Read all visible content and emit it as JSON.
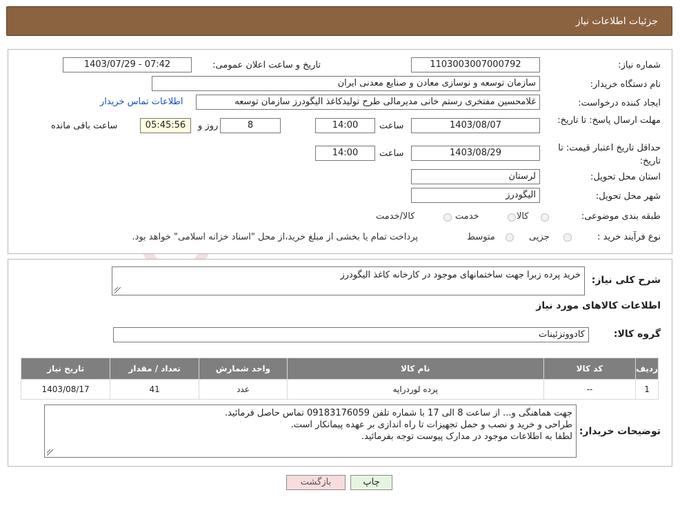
{
  "header": {
    "title": "جزئیات اطلاعات نیاز"
  },
  "form": {
    "need_number_label": "شماره نیاز:",
    "need_number": "1103003007000792",
    "announce_label": "تاریخ و ساعت اعلان عمومی:",
    "announce_value": "1403/07/29 - 07:42",
    "buyer_org_label": "نام دستگاه خریدار:",
    "buyer_org": "سازمان توسعه و نوسازی معادن و صنایع معدنی ایران",
    "creator_label": "ایجاد کننده درخواست:",
    "creator": "غلامحسین مفتخری رستم خانی مدیرمالی طرح تولیدکاغذ الیگودرز سازمان توسعه",
    "contact_link": "اطلاعات تماس خریدار",
    "reply_deadline_label": "مهلت ارسال پاسخ: تا تاریخ:",
    "reply_date": "1403/08/07",
    "time_label": "ساعت",
    "reply_time": "14:00",
    "days_value": "8",
    "day_and_label": "روز و",
    "remaining_time": "05:45:56",
    "remaining_label": "ساعت باقی مانده",
    "price_validity_label": "حداقل تاریخ اعتبار قیمت: تا تاریخ:",
    "price_date": "1403/08/29",
    "price_time": "14:00",
    "province_label": "استان محل تحویل:",
    "province": "لرستان",
    "city_label": "شهر محل تحویل:",
    "city": "الیگودرز",
    "category_label": "طبقه بندی موضوعی:",
    "category_options": [
      "کالا",
      "خدمت",
      "کالا/خدمت"
    ],
    "process_label": "نوع فرآیند خرید :",
    "process_options": [
      "جزیی",
      "متوسط"
    ],
    "process_note": "پرداخت تمام یا بخشی از مبلغ خرید،از محل \"اسناد خزانه اسلامی\" خواهد بود."
  },
  "details": {
    "summary_label": "شرح کلی نیاز:",
    "summary": "خرید پرده زبرا جهت ساختمانهای موجود در کارخانه کاغذ الیگودرز",
    "goods_info_title": "اطلاعات کالاهای مورد نیاز",
    "goods_group_label": "گروه کالا:",
    "goods_group": "کادووتزئینات",
    "table": {
      "headers": [
        "ردیف",
        "کد کالا",
        "نام کالا",
        "واحد شمارش",
        "تعداد / مقدار",
        "تاریخ نیاز"
      ],
      "rows": [
        [
          "1",
          "--",
          "پرده لوردراپه",
          "عدد",
          "41",
          "1403/08/17"
        ]
      ]
    },
    "buyer_notes_label": "توضیحات خریدار:",
    "buyer_notes": [
      "جهت هماهنگی و... از ساعت 8 الی 17 با شماره تلفن 09183176059 تماس حاصل فرمائید.",
      "طراحی و خرید و نصب و حمل تجهیزات تا راه اندازی بر عهده پیمانکار است.",
      "لطفا به اطلاعات موجود در مدارک پیوست توجه بفرمائید."
    ]
  },
  "buttons": {
    "print": "چاپ",
    "back": "بازگشت"
  },
  "watermark": {
    "text": "AriaTender.net"
  },
  "colors": {
    "header_bg": "#8b6340",
    "table_header_bg": "#7f7f7f",
    "link": "#1a4fc4",
    "print_bg": "#e6f5e0",
    "back_bg": "#f9dcdc",
    "watermark": "#c0392b"
  }
}
